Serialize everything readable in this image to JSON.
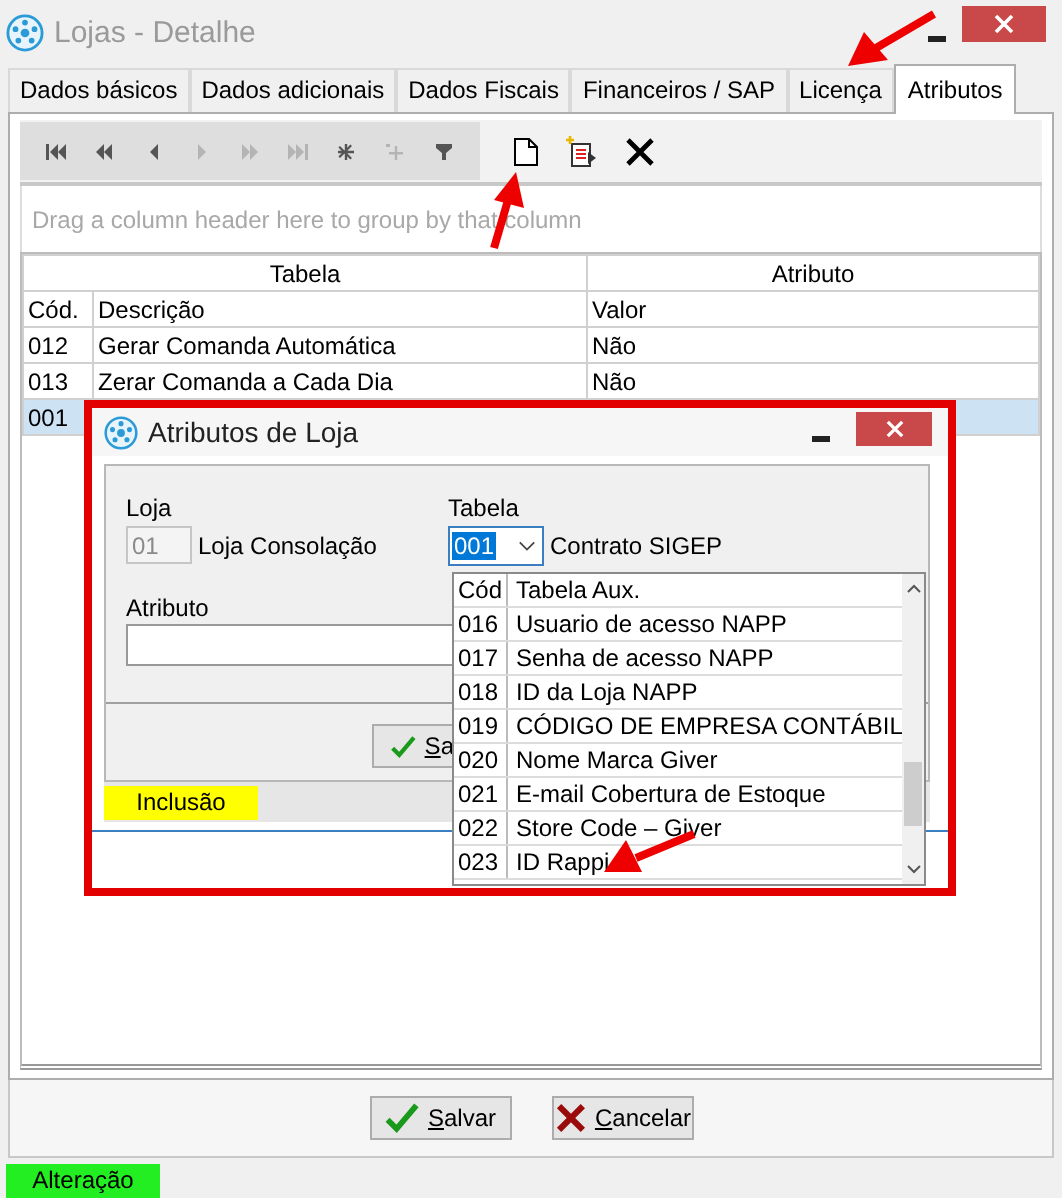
{
  "window": {
    "title": "Lojas - Detalhe"
  },
  "tabs": [
    {
      "label": "Dados básicos",
      "selected": false
    },
    {
      "label": "Dados adicionais",
      "selected": false
    },
    {
      "label": "Dados Fiscais",
      "selected": false
    },
    {
      "label": "Financeiros / SAP",
      "selected": false
    },
    {
      "label": "Licença",
      "selected": false
    },
    {
      "label": "Atributos",
      "selected": true
    }
  ],
  "navigator": [
    {
      "kind": "first",
      "disabled": false
    },
    {
      "kind": "prior-page",
      "disabled": false
    },
    {
      "kind": "prior",
      "disabled": false
    },
    {
      "kind": "next",
      "disabled": true
    },
    {
      "kind": "next-page",
      "disabled": true
    },
    {
      "kind": "last",
      "disabled": true
    },
    {
      "kind": "insert",
      "disabled": false
    },
    {
      "kind": "append",
      "disabled": true
    },
    {
      "kind": "filter",
      "disabled": false
    }
  ],
  "group_panel": {
    "hint": "Drag a column header here to group by that column"
  },
  "grid": {
    "bands": [
      "Tabela",
      "Atributo"
    ],
    "columns": [
      "Cód.",
      "Descrição",
      "Valor"
    ],
    "rows": [
      {
        "cells": [
          "012",
          "Gerar Comanda Automática",
          "Não"
        ],
        "selected": false
      },
      {
        "cells": [
          "013",
          "Zerar Comanda a Cada Dia",
          "Não"
        ],
        "selected": false
      },
      {
        "cells": [
          "001"
        ],
        "selected": true
      }
    ]
  },
  "buttons": [
    {
      "kind": "save",
      "label": "Salvar"
    },
    {
      "kind": "cancel",
      "label": "Cancelar"
    }
  ],
  "status": {
    "label": "Alteração",
    "color": "#22ee22"
  },
  "dialog": {
    "title": "Atributos de Loja",
    "loja": {
      "label": "Loja",
      "code": "01",
      "name": "Loja Consolação"
    },
    "tabela": {
      "label": "Tabela",
      "code": "001",
      "name": "Contrato SIGEP"
    },
    "atributo": {
      "label": "Atributo"
    },
    "button": {
      "kind": "save",
      "label": "Sa"
    },
    "status": {
      "label": "Inclusão",
      "color": "#ffff00"
    },
    "dropdown": {
      "columns": [
        "Cód",
        "Tabela Aux."
      ],
      "rows": [
        {
          "code": "016",
          "name": "Usuario de acesso NAPP"
        },
        {
          "code": "017",
          "name": "Senha de acesso NAPP"
        },
        {
          "code": "018",
          "name": "ID da Loja NAPP"
        },
        {
          "code": "019",
          "name": "CÓDIGO DE EMPRESA CONTÁBIL"
        },
        {
          "code": "020",
          "name": "Nome Marca Giver"
        },
        {
          "code": "021",
          "name": "E-mail Cobertura de Estoque"
        },
        {
          "code": "022",
          "name": "Store Code – Giver"
        },
        {
          "code": "023",
          "name": "ID Rappi"
        }
      ]
    }
  }
}
